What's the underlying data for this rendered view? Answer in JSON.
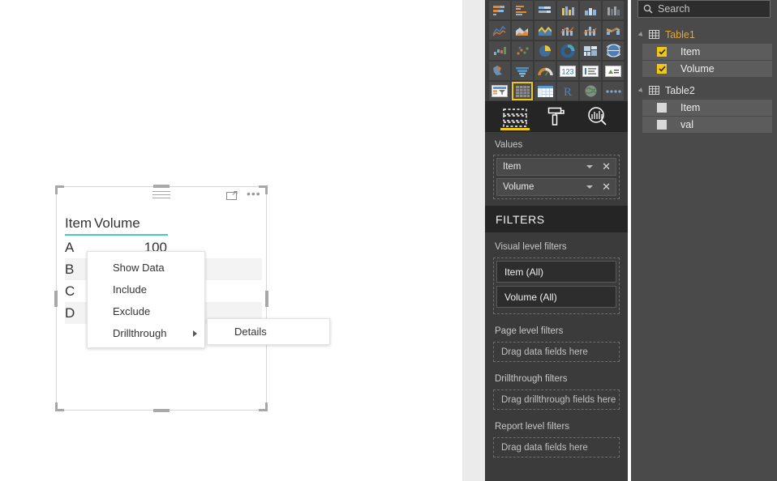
{
  "visual": {
    "name": "table-visual",
    "header_underline_color": "#4ec5c1",
    "columns": [
      "Item",
      "Volume"
    ],
    "rows": [
      {
        "item": "A",
        "volume": "100"
      },
      {
        "item": "B",
        "volume": ""
      },
      {
        "item": "C",
        "volume": ""
      },
      {
        "item": "D",
        "volume": ""
      }
    ],
    "icons": {
      "grip": "drag-grip-icon",
      "focus": "focus-mode-icon",
      "more": "more-options-icon"
    }
  },
  "context_menu": {
    "items": [
      {
        "label": "Show Data",
        "has_submenu": false
      },
      {
        "label": "Include",
        "has_submenu": false
      },
      {
        "label": "Exclude",
        "has_submenu": false
      },
      {
        "label": "Drillthrough",
        "has_submenu": true
      }
    ],
    "submenu": {
      "items": [
        {
          "label": "Details"
        }
      ]
    }
  },
  "visualizations": {
    "gallery_rows": [
      [
        "stacked-bar-chart-icon",
        "clustered-bar-chart-icon",
        "hundred-percent-stacked-bar-chart-icon",
        "stacked-column-chart-icon",
        "clustered-column-chart-icon",
        "hundred-percent-stacked-column-chart-icon"
      ],
      [
        "line-chart-icon",
        "area-chart-icon",
        "stacked-area-chart-icon",
        "line-and-stacked-column-chart-icon",
        "line-and-clustered-column-chart-icon",
        "ribbon-chart-icon"
      ],
      [
        "waterfall-chart-icon",
        "scatter-chart-icon",
        "pie-chart-icon",
        "donut-chart-icon",
        "treemap-icon",
        "map-icon"
      ],
      [
        "filled-map-icon",
        "funnel-chart-icon",
        "gauge-chart-icon",
        "card-icon",
        "multi-row-card-icon",
        "kpi-icon"
      ],
      [
        "slicer-icon",
        "table-icon",
        "matrix-icon",
        "r-script-visual-icon",
        "arcgis-map-icon",
        "more-visuals-icon"
      ]
    ],
    "selected_visual": "table-icon",
    "tabs": [
      {
        "name": "fields-tab",
        "icon": "fields-icon",
        "selected": true
      },
      {
        "name": "format-tab",
        "icon": "paint-roller-icon",
        "selected": false
      },
      {
        "name": "analytics-tab",
        "icon": "analytics-magnifier-icon",
        "selected": false
      }
    ],
    "well_label": "Values",
    "wells": [
      {
        "name": "Item"
      },
      {
        "name": "Volume"
      }
    ],
    "chip_caret_icon": "chevron-down-icon",
    "chip_remove_icon": "remove-field-icon",
    "accent_color": "#f2c811"
  },
  "filters": {
    "title": "FILTERS",
    "sections": [
      {
        "label": "Visual level filters",
        "chips": [
          "Item  (All)",
          "Volume  (All)"
        ],
        "dropzones": []
      },
      {
        "label": "Page level filters",
        "chips": [],
        "dropzones": [
          "Drag data fields here"
        ]
      },
      {
        "label": "Drillthrough filters",
        "chips": [],
        "dropzones": [
          "Drag drillthrough fields here"
        ]
      },
      {
        "label": "Report level filters",
        "chips": [],
        "dropzones": [
          "Drag data fields here"
        ]
      }
    ]
  },
  "fields": {
    "search": {
      "placeholder": "Search",
      "value": "",
      "icon": "search-icon"
    },
    "tables": [
      {
        "name": "Table1",
        "highlighted": true,
        "fields": [
          {
            "name": "Item",
            "checked": true
          },
          {
            "name": "Volume",
            "checked": true
          }
        ]
      },
      {
        "name": "Table2",
        "highlighted": false,
        "fields": [
          {
            "name": "Item",
            "checked": false
          },
          {
            "name": "val",
            "checked": false
          }
        ]
      }
    ]
  }
}
